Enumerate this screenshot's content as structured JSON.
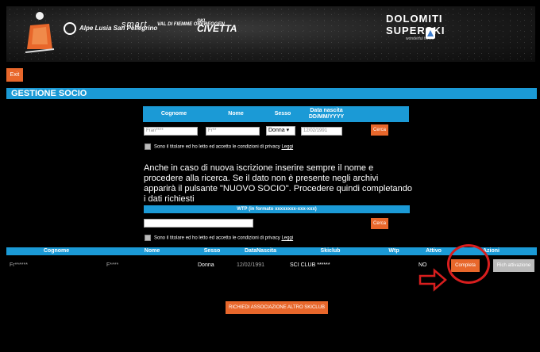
{
  "header": {
    "logo_alpe": "Alpe Lusia San Pellegrino",
    "logo_smart": "smart",
    "logo_valdifiemme": "VAL DI FIEMME OBEREGGEN",
    "logo_civetta": "CIVETTA",
    "logo_civetta_top": "SKI",
    "brand_line1": "DOLOMITI",
    "brand_line2": "SUPERSKI",
    "brand_tagline": "wonderful times"
  },
  "toolbar": {
    "exit_label": "Exit"
  },
  "section": {
    "title": "GESTIONE SOCIO"
  },
  "search_form": {
    "headers": {
      "cognome": "Cognome",
      "nome": "Nome",
      "sesso": "Sesso",
      "data_line1": "Data nascita",
      "data_line2": "DD/MM/YYYY"
    },
    "cognome_value": "Fran****",
    "nome_value": "Fr**",
    "sesso_value": "Donna",
    "data_value": "12/02/1991",
    "search_label": "Cerca",
    "privacy_text": "Sono il titolare ed ho letto ed accetto le condizioni di privacy",
    "privacy_link": "Leggi"
  },
  "notice": "Anche in caso di nuova iscrizione inserire sempre il nome e procedere alla ricerca. Se il dato non è presente negli archivi apparirà il pulsante \"NUOVO SOCIO\". Procedere quindi completando i dati richiesti",
  "wtp_form": {
    "header": "WTP (in formato xxxxxxxx-xxx-xxx)",
    "value": "",
    "search_label": "Cerca",
    "privacy_text": "Sono il titolare ed ho letto ed accetto le condizioni di privacy",
    "privacy_link": "Leggi"
  },
  "results": {
    "columns": [
      "Cognome",
      "Nome",
      "Sesso",
      "DataNascita",
      "Skiclub",
      "Wtp",
      "Attivo",
      "Azioni"
    ],
    "rows": [
      {
        "cognome": "Fr******",
        "nome": "F****",
        "sesso": "Donna",
        "data_nascita": "12/02/1991",
        "skiclub": "SCI CLUB ******",
        "wtp": "",
        "attivo": "NO",
        "action_complete": "Completa",
        "action_request": "Rich attivazione"
      }
    ]
  },
  "footer": {
    "associate_label": "RICHIEDI ASSOCIAZIONE ALTRO SKICLUB"
  },
  "colors": {
    "accent_blue": "#1b9ad6",
    "button_orange": "#e8672b",
    "highlight_red": "#d81e1e"
  }
}
